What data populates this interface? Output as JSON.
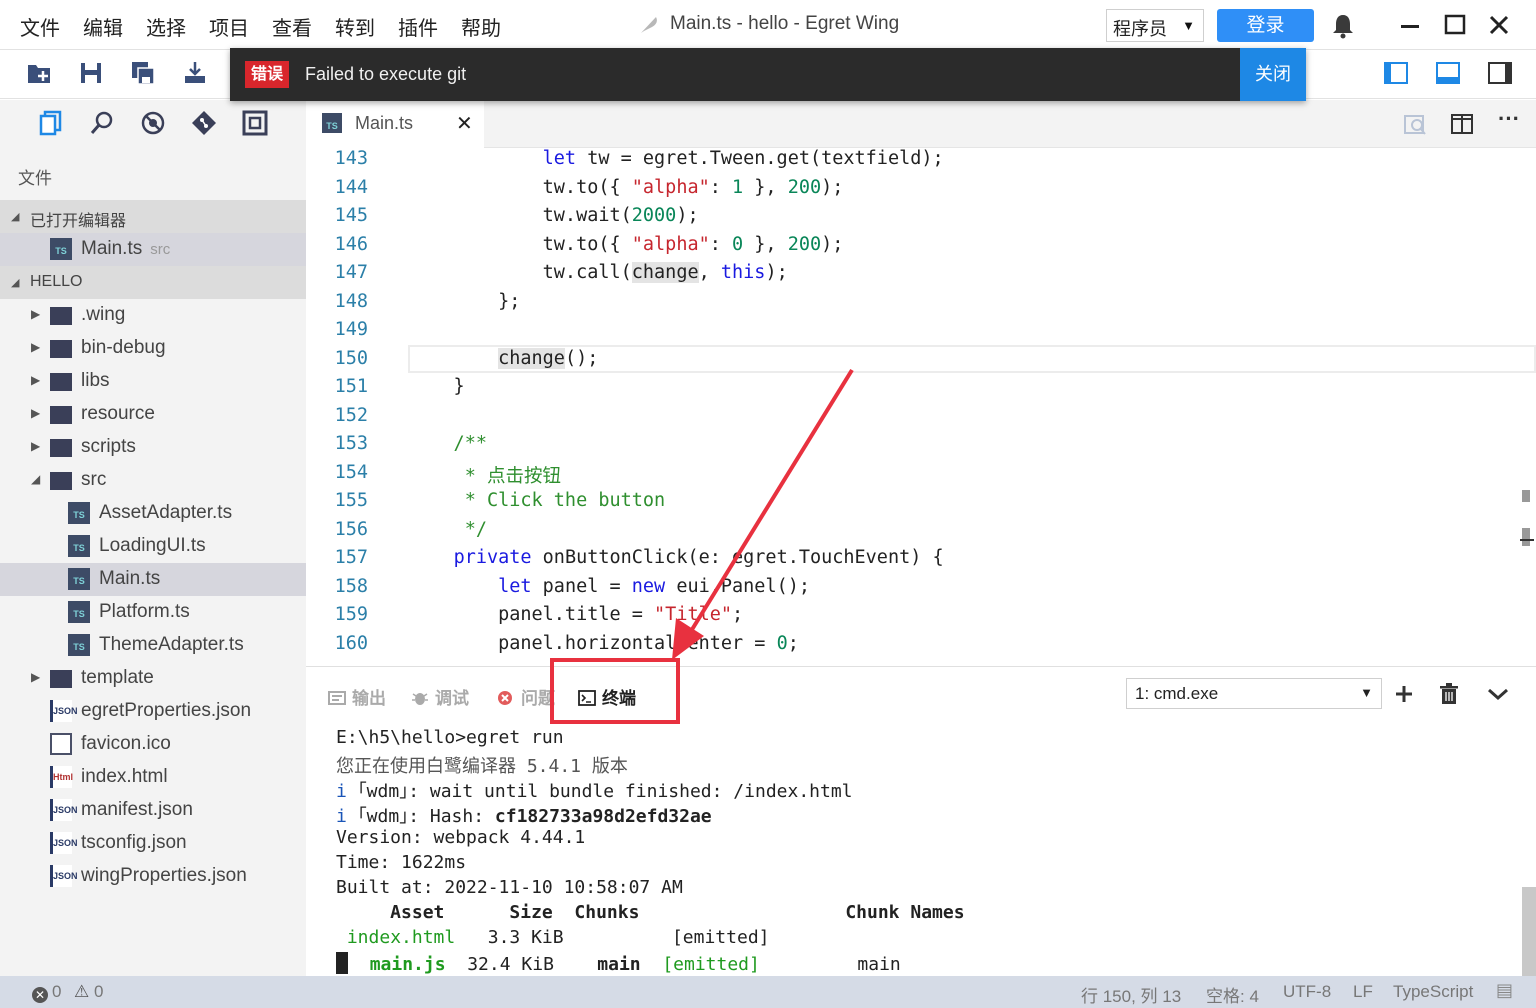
{
  "menu": [
    "文件",
    "编辑",
    "选择",
    "项目",
    "查看",
    "转到",
    "插件",
    "帮助"
  ],
  "window_title": "Main.ts - hello - Egret Wing",
  "role_select": {
    "value": "程序员"
  },
  "login_label": "登录",
  "notification": {
    "badge": "错误",
    "message": "Failed to execute git",
    "close_label": "关闭"
  },
  "sidebar": {
    "section_title": "文件",
    "open_editors": {
      "title": "已打开编辑器",
      "items": [
        {
          "name": "Main.ts",
          "path": "src"
        }
      ]
    },
    "project": {
      "title": "HELLO",
      "items": [
        {
          "name": ".wing",
          "type": "folder"
        },
        {
          "name": "bin-debug",
          "type": "folder"
        },
        {
          "name": "libs",
          "type": "folder"
        },
        {
          "name": "resource",
          "type": "folder"
        },
        {
          "name": "scripts",
          "type": "folder"
        },
        {
          "name": "src",
          "type": "folder-open"
        },
        {
          "name": "AssetAdapter.ts",
          "type": "ts"
        },
        {
          "name": "LoadingUI.ts",
          "type": "ts"
        },
        {
          "name": "Main.ts",
          "type": "ts",
          "selected": true
        },
        {
          "name": "Platform.ts",
          "type": "ts"
        },
        {
          "name": "ThemeAdapter.ts",
          "type": "ts"
        },
        {
          "name": "template",
          "type": "folder"
        },
        {
          "name": "egretProperties.json",
          "type": "json"
        },
        {
          "name": "favicon.ico",
          "type": "file"
        },
        {
          "name": "index.html",
          "type": "html"
        },
        {
          "name": "manifest.json",
          "type": "json"
        },
        {
          "name": "tsconfig.json",
          "type": "json"
        },
        {
          "name": "wingProperties.json",
          "type": "json"
        }
      ]
    }
  },
  "editor": {
    "tab_label": "Main.ts",
    "tab_icon_text": "TS",
    "lines": [
      {
        "n": "143",
        "text": "        let tw = egret.Tween.get(textfield);"
      },
      {
        "n": "144",
        "text": "        tw.to({ \"alpha\": 1 }, 200);"
      },
      {
        "n": "145",
        "text": "        tw.wait(2000);"
      },
      {
        "n": "146",
        "text": "        tw.to({ \"alpha\": 0 }, 200);"
      },
      {
        "n": "147",
        "text": "        tw.call(change, this);"
      },
      {
        "n": "148",
        "text": "    };"
      },
      {
        "n": "149",
        "text": ""
      },
      {
        "n": "150",
        "text": "    change();"
      },
      {
        "n": "151",
        "text": "}"
      },
      {
        "n": "152",
        "text": ""
      },
      {
        "n": "153",
        "text": "/**"
      },
      {
        "n": "154",
        "text": " * 点击按钮"
      },
      {
        "n": "155",
        "text": " * Click the button"
      },
      {
        "n": "156",
        "text": " */"
      },
      {
        "n": "157",
        "text": "private onButtonClick(e: egret.TouchEvent) {"
      },
      {
        "n": "158",
        "text": "    let panel = new eui.Panel();"
      },
      {
        "n": "159",
        "text": "    panel.title = \"Title\";"
      },
      {
        "n": "160",
        "text": "    panel.horizontalCenter = 0;"
      }
    ]
  },
  "panel": {
    "tabs": [
      "输出",
      "调试",
      "问题",
      "终端"
    ],
    "active_tab": "终端",
    "terminal_select": "1: cmd.exe",
    "terminal_lines": [
      "E:\\h5\\hello>egret run",
      "您正在使用白鹭编译器 5.4.1 版本",
      "i ｢wdm｣: wait until bundle finished: /index.html",
      "i ｢wdm｣: Hash: cf182733a98d2efd32ae",
      "Version: webpack 4.44.1",
      "Time: 1622ms",
      "Built at: 2022-11-10 10:58:07 AM",
      "     Asset      Size  Chunks                   Chunk Names",
      "index.html   3.3 KiB          [emitted]",
      "   main.js  32.4 KiB    main  [emitted]         main"
    ]
  },
  "status": {
    "errors": "0",
    "warnings": "0",
    "position": "行 150, 列 13",
    "indent": "空格: 4",
    "encoding": "UTF-8",
    "eol": "LF",
    "language": "TypeScript"
  },
  "colors": {
    "accent": "#2f8ff7",
    "error_badge": "#d8262c",
    "highlight": "#e8313f",
    "status_bar": "#d5dbe6"
  }
}
